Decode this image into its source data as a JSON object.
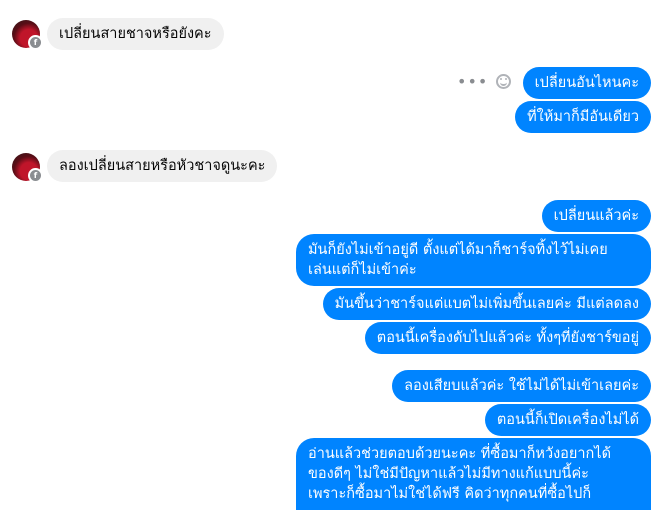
{
  "messages": [
    {
      "side": "in",
      "text": "เปลี่ยนสายชาจหรือยังคะ"
    },
    {
      "side": "out",
      "text": "เปลี่ยนอันไหนคะ"
    },
    {
      "side": "out",
      "text": "ที่ให้มาก็มีอันเดียว"
    },
    {
      "side": "in",
      "text": "ลองเปลี่ยนสายหรือหัวชาจดูนะคะ"
    },
    {
      "side": "out",
      "text": "เปลี่ยนแล้วค่ะ"
    },
    {
      "side": "out",
      "text": "มันก็ยังไม่เข้าอยู่ดี ตั้งแต่ได้มาก็ชาร์จทิ้งไว้ไม่เคย\nเล่นแต่ก็ไม่เข้าค่ะ"
    },
    {
      "side": "out",
      "text": "มันขึ้นว่าชาร์จแต่แบตไม่เพิ่มขึ้นเลยค่ะ มีแต่ลดลง"
    },
    {
      "side": "out",
      "text": "ตอนนี้เครื่องดับไปแล้วค่ะ ทั้งๆที่ยังชาร์ขอยู่"
    },
    {
      "side": "out",
      "text": "ลองเสียบแล้วค่ะ ใช้ไม่ได้ไม่เข้าเลยค่ะ"
    },
    {
      "side": "out",
      "text": "ตอนนี้ก็เปิดเครื่องไม่ได้"
    },
    {
      "side": "out",
      "text": "อ่านแล้วช่วยตอบด้วยนะคะ ที่ซื้อมาก็หวังอยากได้\nของดีๆ ไม่ใช่มีปัญหาแล้วไม่มีทางแก้แบบนี้ค่ะ\nเพราะก็ซื้อมาไม่ใช่ได้ฟรี คิดว่าทุกคนที่ซื้อไปก็"
    }
  ],
  "avatar_badge": "f",
  "icons": {
    "more": "more-dots-icon",
    "react": "emoji-smile-icon"
  },
  "colors": {
    "outgoing": "#0084ff",
    "incoming": "#f0f0f0"
  }
}
